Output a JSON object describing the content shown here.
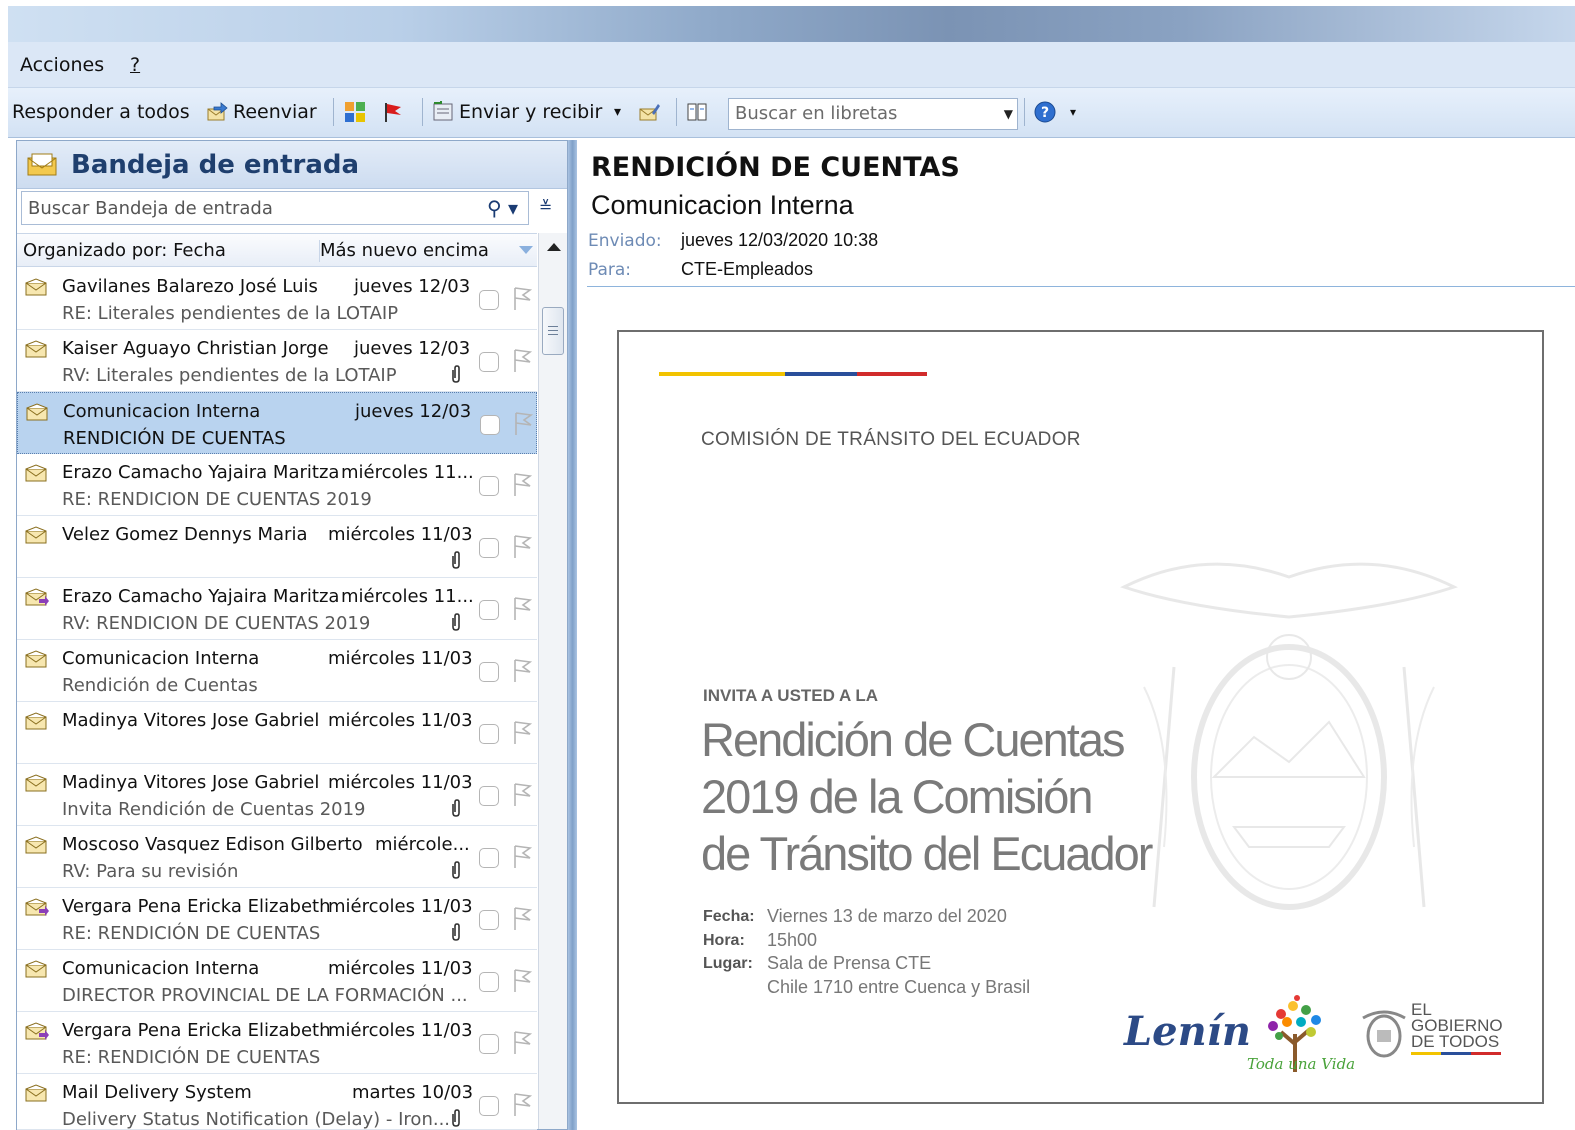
{
  "menu": {
    "acciones": "Acciones",
    "help": "?"
  },
  "toolbar": {
    "reply_all": "Responder a todos",
    "forward": "Reenviar",
    "send_receive": "Enviar y recibir",
    "dropdown_arrow": "▾",
    "address_search_placeholder": "Buscar en libretas"
  },
  "inbox": {
    "title": "Bandeja de entrada",
    "search_placeholder": "Buscar Bandeja de entrada",
    "sort_by": "Organizado por: Fecha",
    "sort_order": "Más nuevo encima",
    "messages": [
      {
        "sender": "Gavilanes Balarezo José Luis",
        "date": "jueves 12/03",
        "subject": "RE: Literales pendientes de la LOTAIP"
      },
      {
        "sender": "Kaiser Aguayo Christian Jorge",
        "date": "jueves 12/03",
        "subject": "RV: Literales pendientes de la LOTAIP"
      },
      {
        "sender": "Comunicacion Interna",
        "date": "jueves 12/03",
        "subject": "RENDICIÓN DE CUENTAS"
      },
      {
        "sender": "Erazo Camacho Yajaira Maritza",
        "date": "miércoles 11...",
        "subject": "RE: RENDICION DE CUENTAS 2019"
      },
      {
        "sender": "Velez Gomez Dennys Maria",
        "date": "miércoles 11/03",
        "subject": ""
      },
      {
        "sender": "Erazo Camacho Yajaira Maritza",
        "date": "miércoles 11...",
        "subject": "RV: RENDICION DE CUENTAS 2019"
      },
      {
        "sender": "Comunicacion Interna",
        "date": "miércoles 11/03",
        "subject": "Rendición de Cuentas"
      },
      {
        "sender": "Madinya Vitores Jose Gabriel",
        "date": "miércoles 11/03",
        "subject": ""
      },
      {
        "sender": "Madinya Vitores Jose Gabriel",
        "date": "miércoles 11/03",
        "subject": "Invita Rendición de Cuentas 2019"
      },
      {
        "sender": "Moscoso Vasquez Edison Gilberto",
        "date": "miércole...",
        "subject": "RV: Para su revisión"
      },
      {
        "sender": "Vergara Pena Ericka Elizabeth",
        "date": "miércoles 11/03",
        "subject": "RE: RENDICIÓN DE CUENTAS"
      },
      {
        "sender": "Comunicacion Interna",
        "date": "miércoles 11/03",
        "subject": "DIRECTOR PROVINCIAL DE LA FORMACIÓN ..."
      },
      {
        "sender": "Vergara Pena Ericka Elizabeth",
        "date": "miércoles 11/03",
        "subject": "RE: RENDICIÓN DE CUENTAS"
      },
      {
        "sender": "Mail Delivery System",
        "date": "martes 10/03",
        "subject": "Delivery Status Notification (Delay) - Iron..."
      }
    ]
  },
  "reading": {
    "subject": "RENDICIÓN DE CUENTAS",
    "from": "Comunicacion Interna",
    "sent_label": "Enviado:",
    "sent_value": "jueves 12/03/2020 10:38",
    "to_label": "Para:",
    "to_value": "CTE-Empleados",
    "invitation": {
      "organization": "COMISIÓN DE TRÁNSITO DEL ECUADOR",
      "invite_line": "INVITA A USTED A LA",
      "event_line1": "Rendición de Cuentas",
      "event_line2": "2019 de la Comisión",
      "event_line3": "de Tránsito del Ecuador",
      "fecha_label": "Fecha:",
      "fecha_value": "Viernes 13 de marzo del 2020",
      "hora_label": "Hora:",
      "hora_value": "15h00",
      "lugar_label": "Lugar:",
      "lugar_value1": "Sala de Prensa CTE",
      "lugar_value2": "Chile 1710 entre Cuenca y Brasil",
      "signature": "Lenín",
      "toda_una_vida": "Toda una Vida",
      "gob_line1": "EL",
      "gob_line2": "GOBIERNO",
      "gob_line3": "DE TODOS"
    }
  },
  "colors": {
    "stripe_yellow": "#f2c300",
    "stripe_blue": "#2a4f9a",
    "stripe_red": "#d12b2b",
    "inbox_title": "#1f3f6e",
    "selected_row": "#b9d3ef"
  },
  "icons": {
    "reply_all": "reply-all-icon",
    "forward": "forward-icon",
    "categorize": "categorize-icon",
    "flag": "flag-icon",
    "send_receive": "send-receive-icon",
    "address_book": "address-book-icon",
    "help": "help-icon",
    "envelope": "envelope-icon",
    "attachment": "paperclip-icon"
  }
}
